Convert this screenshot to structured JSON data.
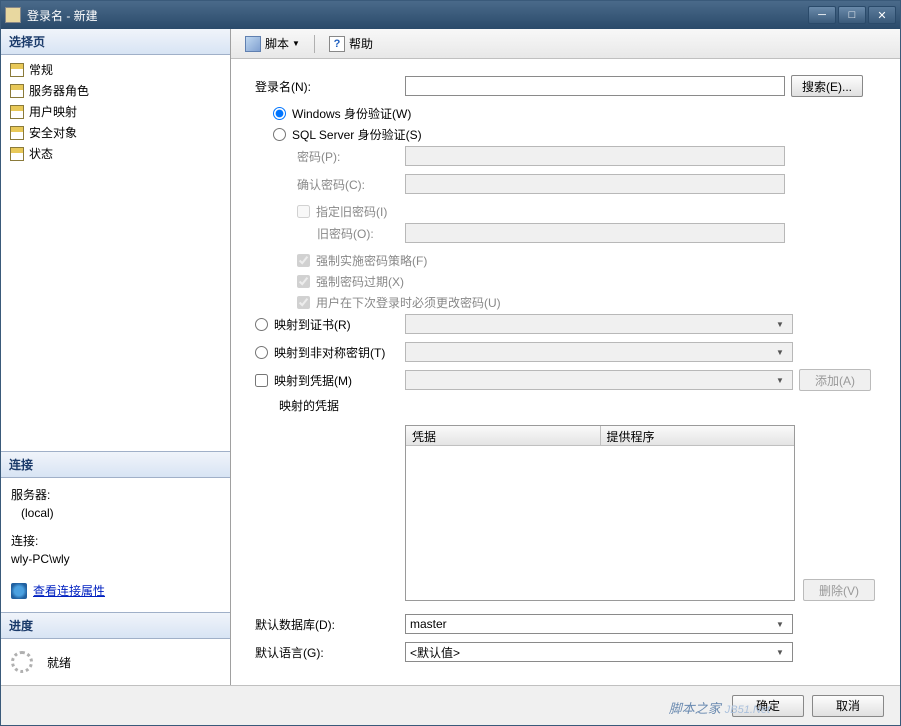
{
  "window": {
    "title": "登录名 - 新建"
  },
  "sidebar": {
    "select_page": "选择页",
    "items": [
      "常规",
      "服务器角色",
      "用户映射",
      "安全对象",
      "状态"
    ],
    "connection_header": "连接",
    "server_label": "服务器:",
    "server_value": "(local)",
    "conn_label": "连接:",
    "conn_value": "wly-PC\\wly",
    "view_props": "查看连接属性",
    "progress_header": "进度",
    "ready": "就绪"
  },
  "toolbar": {
    "script": "脚本",
    "help": "帮助"
  },
  "form": {
    "login_label": "登录名(N):",
    "search_btn": "搜索(E)...",
    "auth_windows": "Windows 身份验证(W)",
    "auth_sql": "SQL Server 身份验证(S)",
    "password": "密码(P):",
    "confirm_password": "确认密码(C):",
    "specify_old": "指定旧密码(I)",
    "old_password": "旧密码(O):",
    "enforce_policy": "强制实施密码策略(F)",
    "enforce_expire": "强制密码过期(X)",
    "must_change": "用户在下次登录时必须更改密码(U)",
    "map_cert": "映射到证书(R)",
    "map_asym": "映射到非对称密钥(T)",
    "map_cred": "映射到凭据(M)",
    "add_btn": "添加(A)",
    "mapped_creds": "映射的凭据",
    "grid_col1": "凭据",
    "grid_col2": "提供程序",
    "remove_btn": "删除(V)",
    "default_db_label": "默认数据库(D):",
    "default_db_value": "master",
    "default_lang_label": "默认语言(G):",
    "default_lang_value": "<默认值>"
  },
  "footer": {
    "ok": "确定",
    "cancel": "取消"
  },
  "watermark": {
    "l1": "脚本之家",
    "l2": "JB51.Net"
  }
}
